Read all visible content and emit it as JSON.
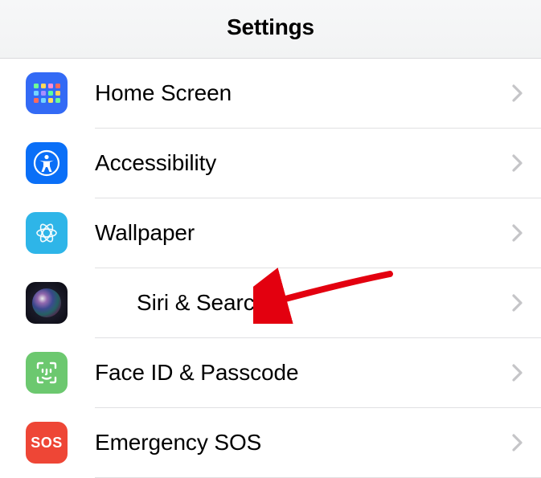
{
  "header": {
    "title": "Settings"
  },
  "rows": [
    {
      "id": "home-screen",
      "label": "Home Screen",
      "icon": "home-screen-icon"
    },
    {
      "id": "accessibility",
      "label": "Accessibility",
      "icon": "accessibility-icon"
    },
    {
      "id": "wallpaper",
      "label": "Wallpaper",
      "icon": "wallpaper-icon"
    },
    {
      "id": "siri-search",
      "label": "Siri & Search",
      "icon": "siri-icon"
    },
    {
      "id": "faceid-passcode",
      "label": "Face ID & Passcode",
      "icon": "faceid-icon"
    },
    {
      "id": "emergency-sos",
      "label": "Emergency SOS",
      "icon": "sos-icon",
      "icon_text": "SOS"
    }
  ],
  "annotation": {
    "type": "arrow",
    "target": "siri-search",
    "color": "#e3000f"
  }
}
